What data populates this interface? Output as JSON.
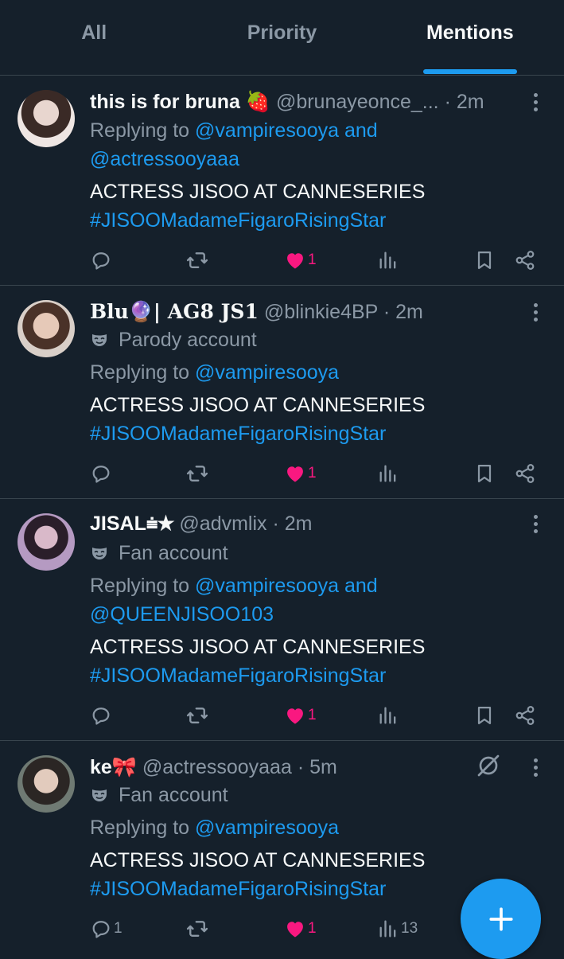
{
  "tabs": [
    {
      "label": "All",
      "active": false
    },
    {
      "label": "Priority",
      "active": false
    },
    {
      "label": "Mentions",
      "active": true
    }
  ],
  "colors": {
    "background": "#15202b",
    "accent": "#1d9bf0",
    "like": "#f91880",
    "muted": "#8b98a5"
  },
  "tweets": [
    {
      "name": "this is for bruna 🍓",
      "handle": "@brunayeonce_...",
      "time": "· 2m",
      "badge": "",
      "replying_prefix": "Replying to ",
      "replying_line1": "@vampiresooya and",
      "replying_line2": "@actressooyaaa",
      "text": "ACTRESS JISOO AT CANNESERIES",
      "hashtag": "#JISOOMadameFigaroRisingStar",
      "replies": "",
      "likes": "1",
      "views": ""
    },
    {
      "name": "Blu🔮| AG8 JS1",
      "handle": "@blinkie4BP",
      "time": "· 2m",
      "badge": "Parody account",
      "replying_prefix": "Replying to ",
      "replying_line1": "@vampiresooya",
      "replying_line2": "",
      "text": "ACTRESS JISOO AT CANNESERIES",
      "hashtag": "#JISOOMadameFigaroRisingStar",
      "replies": "",
      "likes": "1",
      "views": ""
    },
    {
      "name": "JISAL⩧★",
      "handle": "@advmlix",
      "time": "· 2m",
      "badge": "Fan account",
      "replying_prefix": "Replying to ",
      "replying_line1": "@vampiresooya and",
      "replying_line2": "@QUEENJISOO103",
      "text": "ACTRESS JISOO AT CANNESERIES",
      "hashtag": "#JISOOMadameFigaroRisingStar",
      "replies": "",
      "likes": "1",
      "views": ""
    },
    {
      "name": "ke🎀",
      "handle": "@actressooyaaa",
      "time": "· 5m",
      "badge": "Fan account",
      "replying_prefix": "Replying to ",
      "replying_line1": "@vampiresooya",
      "replying_line2": "",
      "text": "ACTRESS JISOO AT CANNESERIES",
      "hashtag": "#JISOOMadameFigaroRisingStar",
      "replies": "1",
      "likes": "1",
      "views": "13"
    }
  ]
}
